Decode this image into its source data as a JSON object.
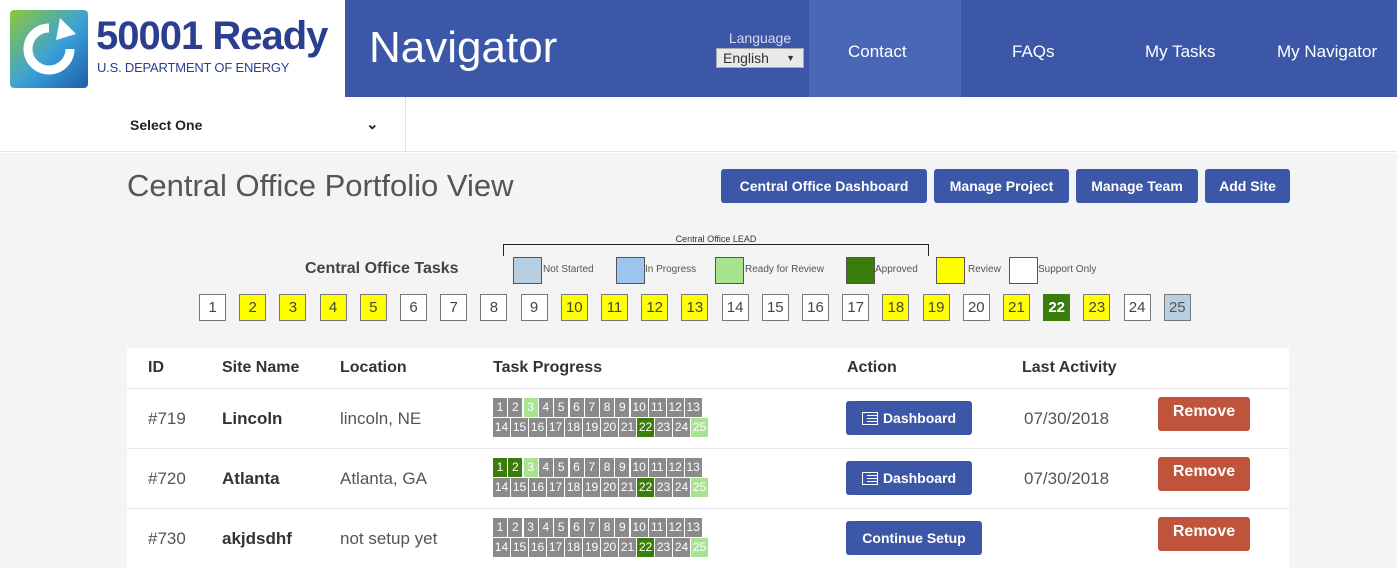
{
  "header": {
    "logo_name": "50001 Ready",
    "logo_sub": "U.S. DEPARTMENT OF ENERGY",
    "title": "Navigator",
    "language_label": "Language",
    "language_value": "English",
    "nav": [
      "Contact",
      "FAQs",
      "My Tasks",
      "My Navigator"
    ]
  },
  "subnav": {
    "select_label": "Select One"
  },
  "page": {
    "title": "Central Office Portfolio View",
    "buttons": [
      "Central Office Dashboard",
      "Manage Project",
      "Manage Team",
      "Add Site"
    ]
  },
  "tasks": {
    "label": "Central Office Tasks",
    "lead_label": "Central Office LEAD",
    "legend": [
      {
        "label": "Not Started",
        "color": "#b7cfe0"
      },
      {
        "label": "In Progress",
        "color": "#9ec5f0"
      },
      {
        "label": "Ready for Review",
        "color": "#a8e38f"
      },
      {
        "label": "Approved",
        "color": "#3a7d0a"
      },
      {
        "label": "Review",
        "color": "#ffff00"
      },
      {
        "label": "Support Only",
        "color": "#ffffff"
      }
    ],
    "numbers": [
      "1",
      "2",
      "3",
      "4",
      "5",
      "6",
      "7",
      "8",
      "9",
      "10",
      "11",
      "12",
      "13",
      "14",
      "15",
      "16",
      "17",
      "18",
      "19",
      "20",
      "21",
      "22",
      "23",
      "24",
      "25"
    ],
    "status": [
      "support",
      "review",
      "review",
      "review",
      "review",
      "support",
      "support",
      "support",
      "support",
      "review",
      "review",
      "review",
      "review",
      "support",
      "support",
      "support",
      "support",
      "review",
      "review",
      "support",
      "review",
      "approved",
      "review",
      "support",
      "notstarted"
    ]
  },
  "colors": {
    "primary": "#3c57a8",
    "danger": "#c0533b",
    "gray": "#8a8a8a",
    "approved": "#3a7d0a",
    "ready": "#a8e38f",
    "review": "#ffff00",
    "not_started": "#b7cfe0"
  },
  "table": {
    "headers": [
      "ID",
      "Site Name",
      "Location",
      "Task Progress",
      "Action",
      "Last Activity"
    ],
    "rows": [
      {
        "id": "#719",
        "name": "Lincoln",
        "location": "lincoln, NE",
        "action": "Dashboard",
        "last_activity": "07/30/2018",
        "remove": "Remove",
        "progress": [
          "g",
          "g",
          "r",
          "g",
          "g",
          "g",
          "g",
          "g",
          "g",
          "g",
          "g",
          "g",
          "g",
          "g",
          "g",
          "g",
          "g",
          "g",
          "g",
          "g",
          "g",
          "a",
          "g",
          "g",
          "r"
        ]
      },
      {
        "id": "#720",
        "name": "Atlanta",
        "location": "Atlanta, GA",
        "action": "Dashboard",
        "last_activity": "07/30/2018",
        "remove": "Remove",
        "progress": [
          "a",
          "a",
          "r",
          "g",
          "g",
          "g",
          "g",
          "g",
          "g",
          "g",
          "g",
          "g",
          "g",
          "g",
          "g",
          "g",
          "g",
          "g",
          "g",
          "g",
          "g",
          "a",
          "g",
          "g",
          "r"
        ]
      },
      {
        "id": "#730",
        "name": "akjdsdhf",
        "location": "not setup yet",
        "action": "Continue Setup",
        "last_activity": "",
        "remove": "Remove",
        "progress": [
          "g",
          "g",
          "g",
          "g",
          "g",
          "g",
          "g",
          "g",
          "g",
          "g",
          "g",
          "g",
          "g",
          "g",
          "g",
          "g",
          "g",
          "g",
          "g",
          "g",
          "g",
          "a",
          "g",
          "g",
          "r"
        ]
      }
    ]
  }
}
